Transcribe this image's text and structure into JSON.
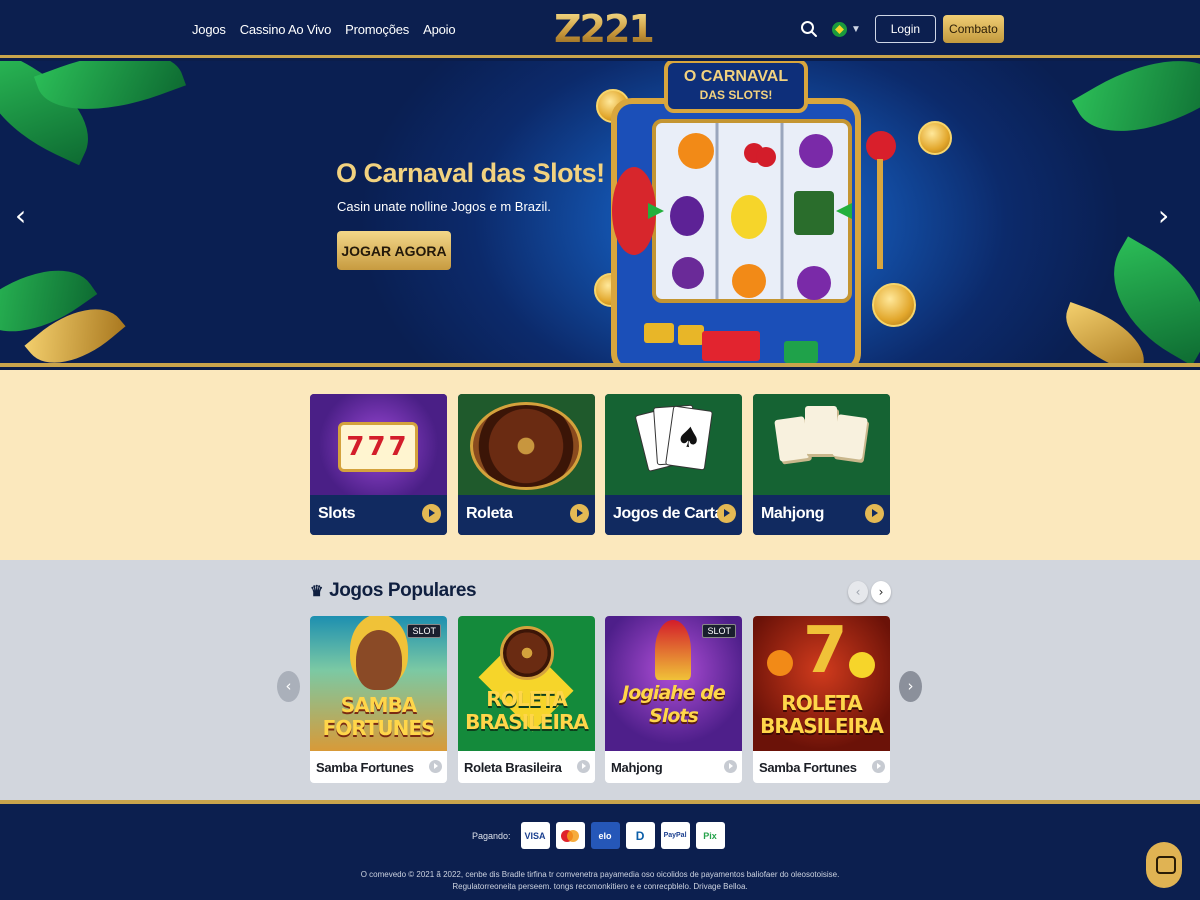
{
  "header": {
    "logo": "Z221",
    "nav": [
      "Jogos",
      "Cassino Ao Vivo",
      "Promoções",
      "Apoio"
    ],
    "login_label": "Login",
    "combat_label": "Combato",
    "icons": {
      "search": "search-icon",
      "language": "brazil-flag-icon"
    }
  },
  "hero": {
    "title": "O Carnaval das Slots!",
    "subtitle": "Casin unate nolline Jogos e m Brazil.",
    "cta": "JOGAR AGORA",
    "machine_sign": "O CARNAVAL DAS SLOTS!"
  },
  "categories": [
    {
      "label": "Slots"
    },
    {
      "label": "Roleta"
    },
    {
      "label": "Jogos de Cartas"
    },
    {
      "label": "Mahjong"
    }
  ],
  "popular": {
    "heading": "Jogos Populares",
    "games": [
      {
        "art_title": "SAMBA FORTUNES",
        "badge": "SLOT",
        "label": "Samba Fortunes"
      },
      {
        "art_title": "ROLETA BRASILEIRA",
        "badge": "",
        "label": "Roleta Brasileira"
      },
      {
        "art_title": "Jogiahe de Slots",
        "badge": "SLOT",
        "label": "Mahjong"
      },
      {
        "art_title": "ROLETA BRASILEIRA",
        "badge": "",
        "label": "Samba Fortunes"
      }
    ]
  },
  "footer": {
    "payment_label": "Pagando:",
    "payments": [
      "VISA",
      "MC",
      "elo",
      "D",
      "PayPal",
      "Pix"
    ],
    "legal_line1": "O comevedo © 2021 ã 2022, cenbe dis Bradle tirfina tr comvenetra payamedia oso oicolidos de payamentos baliofaer do oleosotoisise.",
    "legal_line2": "Regulatorreoneita perseem. tongs recomonkitiero e e conrecpblelo. Drivage Belloa."
  },
  "colors": {
    "navy": "#0c1f4f",
    "gold": "#c9a44c",
    "cream": "#fbe8bd",
    "grey": "#d2d6dd"
  }
}
